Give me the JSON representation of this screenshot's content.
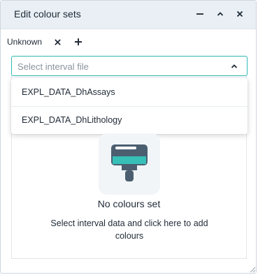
{
  "window": {
    "title": "Edit colour sets",
    "controls": [
      "minimize",
      "collapse",
      "close"
    ]
  },
  "tabs": [
    {
      "label": "Unknown"
    }
  ],
  "interval_select": {
    "placeholder": "Select interval file",
    "options": [
      "EXPL_DATA_DhAssays",
      "EXPL_DATA_DhLithology"
    ]
  },
  "empty_state": {
    "icon": "paint-roller-icon",
    "title": "No colours set",
    "description": "Select interval data and click here to add colours"
  },
  "colors": {
    "accent": "#2fbab3",
    "titlebar": "#e9eff5",
    "icon_fill": "#4b5f70",
    "icon_paint": "#37c0b8"
  }
}
